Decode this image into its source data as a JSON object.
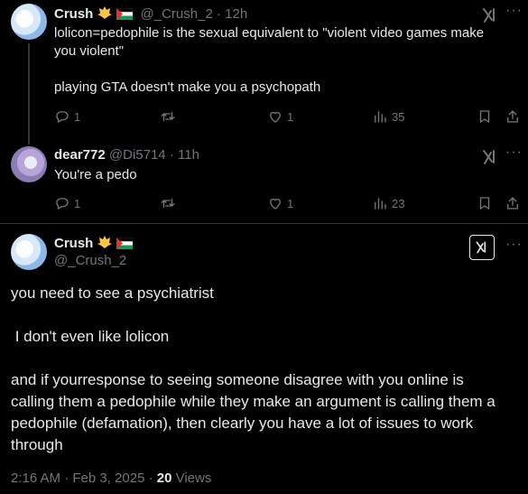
{
  "tweets": [
    {
      "name": "Crush",
      "handle": "@_Crush_2",
      "sep": "·",
      "time": "12h",
      "text_lines": [
        "lolicon=pedophile is the sexual equivalent to \"violent video games make",
        "you violent\"",
        "",
        "playing GTA doesn't make you a psychopath"
      ],
      "replies": "1",
      "likes": "1",
      "views": "35"
    },
    {
      "name": "dear772",
      "handle": "@Di5714",
      "sep": "·",
      "time": "11h",
      "text_lines": [
        "You're a pedo"
      ],
      "replies": "1",
      "likes": "1",
      "views": "23"
    }
  ],
  "main": {
    "name": "Crush",
    "handle": "@_Crush_2",
    "text_lines": [
      "you need to see a psychiatrist",
      "",
      " I don't even like lolicon",
      "",
      "and if yourresponse to seeing someone disagree with you online is",
      "calling them a pedophile while they make an argument is calling them a",
      "pedophile (defamation), then clearly you have a lot of issues to work",
      "through"
    ],
    "timestamp": "2:16 AM · Feb 3, 2025 · ",
    "views_count": "20",
    "views_label": " Views"
  },
  "icons": {
    "reply": "reply-icon",
    "retweet": "retweet-icon",
    "like": "heart-icon",
    "views": "views-chart-icon",
    "bookmark": "bookmark-icon",
    "share": "share-icon",
    "grok": "grok-icon",
    "more": "more-icon"
  },
  "colors": {
    "background": "#000000",
    "text": "#e7e9ea",
    "muted": "#71767b",
    "divider": "#2f3336",
    "badge": "#ffd43b"
  }
}
